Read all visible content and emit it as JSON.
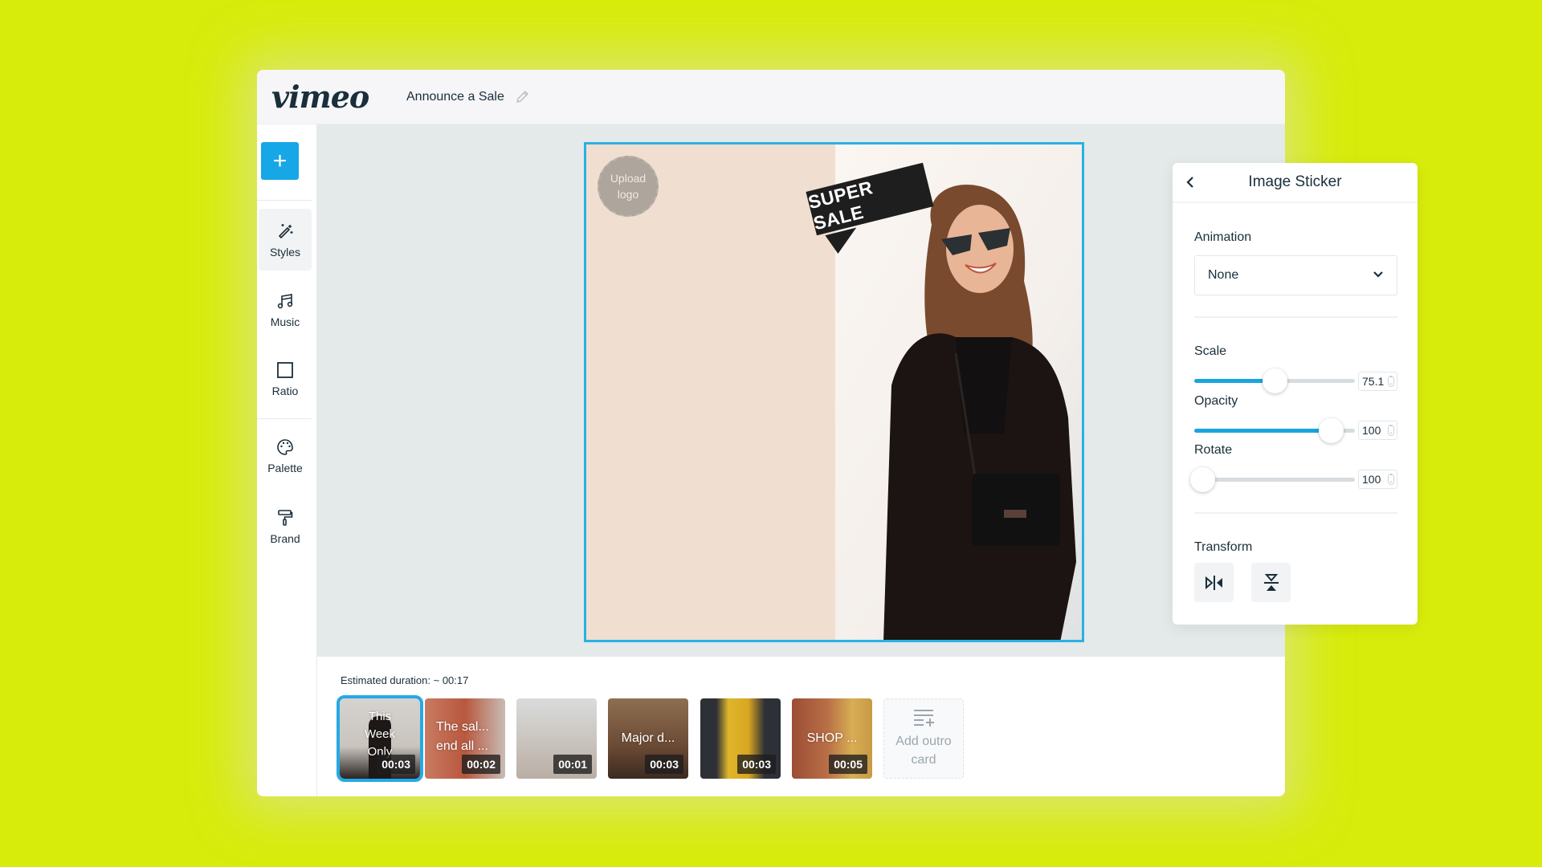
{
  "app": {
    "logo": "vimeo",
    "project_title": "Announce a Sale"
  },
  "sidebar": {
    "add_label": "+",
    "items": [
      {
        "label": "Styles",
        "icon": "magic-wand-icon",
        "active": true
      },
      {
        "label": "Music",
        "icon": "music-note-icon",
        "active": false
      },
      {
        "label": "Ratio",
        "icon": "square-icon",
        "active": false
      },
      {
        "label": "Palette",
        "icon": "palette-icon",
        "active": false
      },
      {
        "label": "Brand",
        "icon": "paint-roller-icon",
        "active": false
      }
    ]
  },
  "canvas": {
    "upload_logo": "Upload logo",
    "upload_logo_line1": "Upload",
    "upload_logo_line2": "logo",
    "sticker_text": "SUPER SALE",
    "colors": {
      "frame": "#2bb0e3",
      "left_panel": "#f0dfd0"
    }
  },
  "timeline": {
    "estimated_duration": "Estimated duration: ~ 00:17",
    "clips": [
      {
        "title": "This Week Only",
        "duration": "00:03",
        "selected": true
      },
      {
        "title": "The sal... end all ...",
        "duration": "00:02",
        "selected": false
      },
      {
        "title": "",
        "duration": "00:01",
        "selected": false
      },
      {
        "title": "Major d...",
        "duration": "00:03",
        "selected": false
      },
      {
        "title": "",
        "duration": "00:03",
        "selected": false
      },
      {
        "title": "SHOP ...",
        "duration": "00:05",
        "selected": false
      }
    ],
    "clip_titles": {
      "c0": "This Week Only",
      "c1a": "The sal...",
      "c1b": "end all ...",
      "c3": "Major d...",
      "c5": "SHOP ..."
    },
    "add_outro": "Add outro card",
    "add_outro_line1": "Add outro",
    "add_outro_line2": "card"
  },
  "panel": {
    "title": "Image Sticker",
    "animation_label": "Animation",
    "animation_value": "None",
    "scale_label": "Scale",
    "scale_value": "75.1",
    "scale_fraction": 0.56,
    "opacity_label": "Opacity",
    "opacity_value": "100",
    "opacity_fraction": 1.0,
    "rotate_label": "Rotate",
    "rotate_value": "100",
    "rotate_fraction": 0.0,
    "transform_label": "Transform",
    "transform_buttons": [
      "flip-horizontal-icon",
      "flip-vertical-icon"
    ]
  },
  "colors": {
    "background": "#d8ec0c",
    "accent": "#17a7e6",
    "text": "#1a2e3b"
  }
}
